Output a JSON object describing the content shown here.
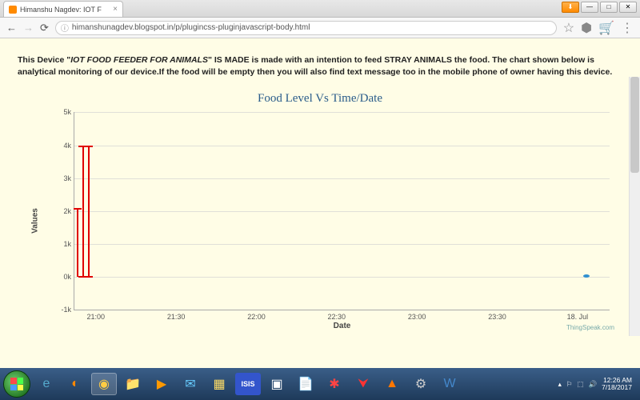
{
  "browser": {
    "tab_title": "Himanshu Nagdev: IOT F",
    "url": "himanshunagdev.blogspot.in/p/plugincss-pluginjavascript-body.html",
    "win_btn_update": "⬇",
    "win_btn_min": "—",
    "win_btn_max": "□",
    "win_btn_close": "✕"
  },
  "page": {
    "desc_pre": "This Device \"",
    "desc_em": "IOT FOOD FEEDER FOR ANIMALS",
    "desc_post": "\" IS MADE is made with an intention to feed STRAY ANIMALS the food. The chart shown below is analytical monitoring of our device.If the food will be empty then you will also find text message too in the mobile phone of owner having this device.",
    "watermark": "ThingSpeak.com"
  },
  "chart_data": {
    "type": "line",
    "title": "Food Level Vs Time/Date",
    "xlabel": "Date",
    "ylabel": "Values",
    "yticks": [
      "-1k",
      "0k",
      "1k",
      "2k",
      "3k",
      "4k",
      "5k"
    ],
    "ylim": [
      -1000,
      5000
    ],
    "xticks": [
      "21:00",
      "21:30",
      "22:00",
      "22:30",
      "23:00",
      "23:30",
      "18. Jul"
    ],
    "series": [
      {
        "name": "red-spikes",
        "color": "#e00000",
        "points": [
          {
            "x_label": "~20:56",
            "y": 0
          },
          {
            "x_label": "~20:56",
            "y": 4000
          },
          {
            "x_label": "~20:58",
            "y": 0
          },
          {
            "x_label": "~20:58",
            "y": 4000
          },
          {
            "x_label": "~20:59",
            "y": 0
          },
          {
            "x_label": "~20:59",
            "y": 2100
          }
        ]
      },
      {
        "name": "blue",
        "color": "#3090d0",
        "points": [
          {
            "x_label": "~18. Jul 00:05",
            "y": 50
          }
        ]
      }
    ],
    "annotations": []
  },
  "taskbar": {
    "icons": [
      "ie",
      "firefox",
      "chrome",
      "explorer",
      "wmp",
      "msg",
      "files",
      "isis",
      "cmd",
      "notepad",
      "bug",
      "acrobat",
      "vlc",
      "gear",
      "word"
    ],
    "tray": {
      "time": "12:26 AM",
      "date": "7/18/2017"
    }
  }
}
